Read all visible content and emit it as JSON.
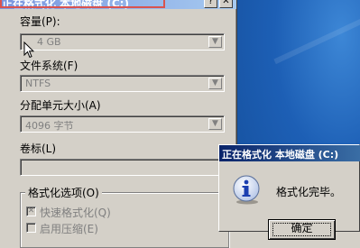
{
  "format_dialog": {
    "title": "正在格式化 本地磁盘 (C:)",
    "capacity": {
      "label": "容量(P):",
      "value": "4 GB"
    },
    "filesystem": {
      "label": "文件系统(F)",
      "value": "NTFS"
    },
    "allocation": {
      "label": "分配单元大小(A)",
      "value": "4096 字节"
    },
    "volume_label": {
      "label": "卷标(L)",
      "value": ""
    },
    "options": {
      "title": "格式化选项(O)",
      "quick_format": {
        "label": "快速格式化(Q)",
        "checked": true,
        "mark": "✕"
      },
      "enable_compression": {
        "label": "启用压缩(E)",
        "checked": false
      }
    },
    "help_symbol": "?",
    "close_symbol": "✕"
  },
  "message_box": {
    "title": "正在格式化 本地磁盘 (C:)",
    "message": "格式化完毕。",
    "ok_label": "确定",
    "icon": "info-icon"
  },
  "colors": {
    "dialog_face": "#d4d0c8",
    "active_title": "#0a246a",
    "inactive_title": "#7a96df",
    "desktop": "#1d5fb5",
    "highlight_border": "#d9534f"
  }
}
